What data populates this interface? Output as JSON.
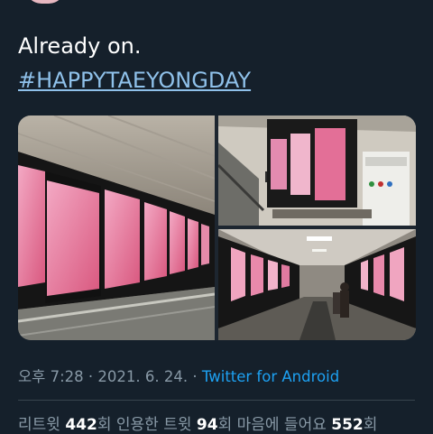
{
  "tweet": {
    "text_line1": "Already on.",
    "hashtag": "#HAPPYTAEYONGDAY"
  },
  "media": [
    {
      "description": "subway-escalator-billboards-pink"
    },
    {
      "description": "station-lightbox-ads-with-sign"
    },
    {
      "description": "escalator-tunnel-ads"
    }
  ],
  "timestamp": {
    "time": "오후 7:28",
    "sep1": " · ",
    "date": "2021. 6. 24.",
    "sep2": " · ",
    "source": "Twitter for Android"
  },
  "stats": {
    "retweets_label": "리트윗 ",
    "retweets_count": "442",
    "retweets_unit": "회  ",
    "quotes_label": "인용한 트윗 ",
    "quotes_count": "94",
    "quotes_unit": "회  ",
    "likes_label": "마음에 들어요 ",
    "likes_count": "552",
    "likes_unit": "회"
  },
  "colors": {
    "background": "#15202b",
    "link": "#1da1f2",
    "hashtag": "#8fc1ea",
    "muted": "#8899a6"
  }
}
